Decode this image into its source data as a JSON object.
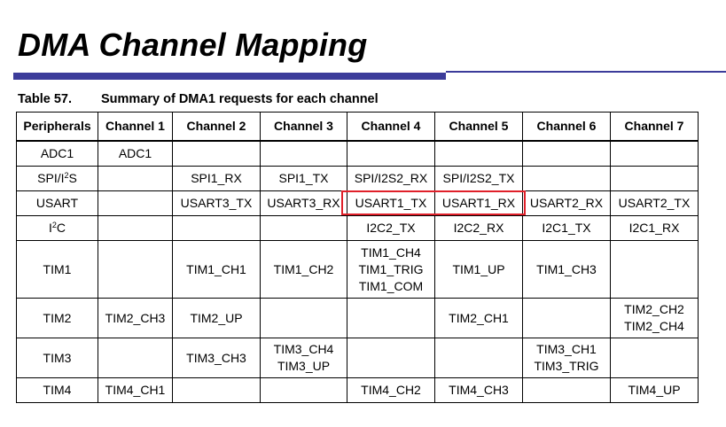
{
  "slide": {
    "title": "DMA Channel Mapping"
  },
  "colors": {
    "title_rule": "#3c3c9a",
    "highlight": "#e0202a"
  },
  "table": {
    "caption_number": "Table 57.",
    "caption_text": "Summary of DMA1 requests for each channel",
    "headers": [
      "Peripherals",
      "Channel 1",
      "Channel 2",
      "Channel 3",
      "Channel 4",
      "Channel 5",
      "Channel 6",
      "Channel 7"
    ],
    "rows": [
      {
        "peripheral": "ADC1",
        "cells": [
          [
            "ADC1"
          ],
          [],
          [],
          [],
          [],
          [],
          []
        ]
      },
      {
        "peripheral_pre": "SPI/I",
        "peripheral_sup": "2",
        "peripheral_post": "S",
        "cells": [
          [],
          [
            "SPI1_RX"
          ],
          [
            "SPI1_TX"
          ],
          [
            "SPI/I2S2_RX"
          ],
          [
            "SPI/I2S2_TX"
          ],
          [],
          []
        ]
      },
      {
        "peripheral": "USART",
        "cells": [
          [],
          [
            "USART3_TX"
          ],
          [
            "USART3_RX"
          ],
          [
            "USART1_TX"
          ],
          [
            "USART1_RX"
          ],
          [
            "USART2_RX"
          ],
          [
            "USART2_TX"
          ]
        ]
      },
      {
        "peripheral_pre": "I",
        "peripheral_sup": "2",
        "peripheral_post": "C",
        "cells": [
          [],
          [],
          [],
          [
            "I2C2_TX"
          ],
          [
            "I2C2_RX"
          ],
          [
            "I2C1_TX"
          ],
          [
            "I2C1_RX"
          ]
        ]
      },
      {
        "peripheral": "TIM1",
        "cells": [
          [],
          [
            "TIM1_CH1"
          ],
          [
            "TIM1_CH2"
          ],
          [
            "TIM1_CH4",
            "TIM1_TRIG",
            "TIM1_COM"
          ],
          [
            "TIM1_UP"
          ],
          [
            "TIM1_CH3"
          ],
          []
        ]
      },
      {
        "peripheral": "TIM2",
        "cells": [
          [
            "TIM2_CH3"
          ],
          [
            "TIM2_UP"
          ],
          [],
          [],
          [
            "TIM2_CH1"
          ],
          [],
          [
            "TIM2_CH2",
            "TIM2_CH4"
          ]
        ]
      },
      {
        "peripheral": "TIM3",
        "cells": [
          [],
          [
            "TIM3_CH3"
          ],
          [
            "TIM3_CH4",
            "TIM3_UP"
          ],
          [],
          [],
          [
            "TIM3_CH1",
            "TIM3_TRIG"
          ],
          []
        ]
      },
      {
        "peripheral": "TIM4",
        "cells": [
          [
            "TIM4_CH1"
          ],
          [],
          [],
          [
            "TIM4_CH2"
          ],
          [
            "TIM4_CH3"
          ],
          [],
          [
            "TIM4_UP"
          ]
        ]
      }
    ]
  }
}
